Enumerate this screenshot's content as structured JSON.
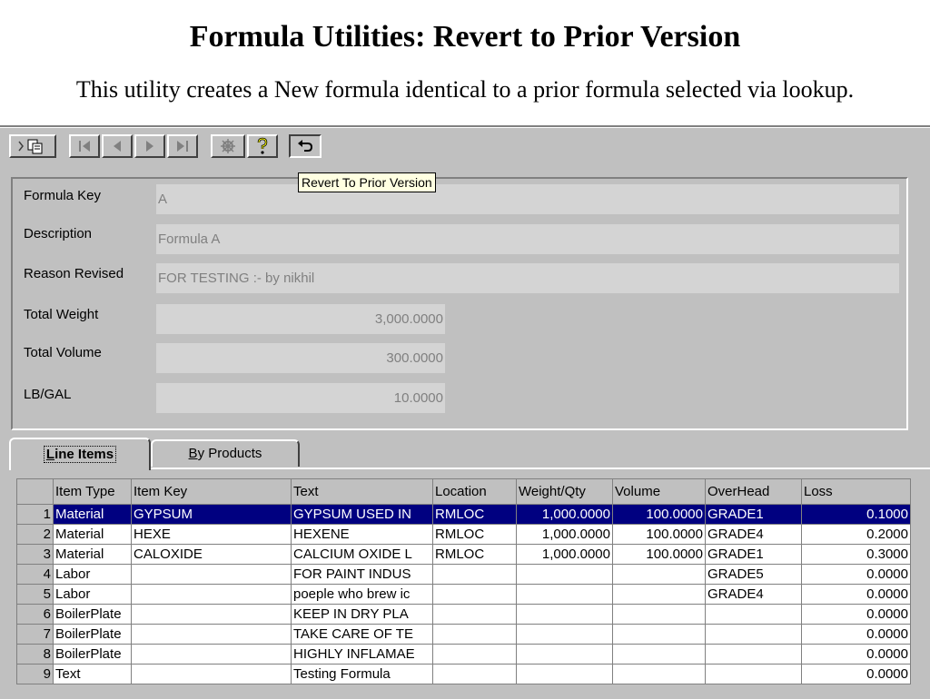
{
  "slide": {
    "title": "Formula Utilities: Revert to Prior Version",
    "subtitle": "This utility creates a New formula identical to a prior formula selected via lookup."
  },
  "toolbar": {
    "buttons": [
      "copy-icon",
      "first-record-icon",
      "previous-record-icon",
      "next-record-icon",
      "last-record-icon",
      "tools-icon",
      "help-icon",
      "revert-icon"
    ],
    "tooltip": "Revert To Prior Version"
  },
  "form": {
    "formula_key": {
      "label": "Formula Key",
      "value": "A"
    },
    "description": {
      "label": "Description",
      "value": "Formula A"
    },
    "reason_revised": {
      "label": "Reason Revised",
      "value": "FOR TESTING :- by nikhil"
    },
    "total_weight": {
      "label": "Total Weight",
      "value": "3,000.0000"
    },
    "total_volume": {
      "label": "Total Volume",
      "value": "300.0000"
    },
    "lb_gal": {
      "label": "LB/GAL",
      "value": "10.0000"
    }
  },
  "tabs": {
    "line_items": {
      "label_mnemonic": "L",
      "label_rest": "ine Items"
    },
    "by_products": {
      "label_mnemonic": "B",
      "label_rest": "y Products"
    }
  },
  "grid": {
    "columns": [
      "Item Type",
      "Item Key",
      "Text",
      "Location",
      "Weight/Qty",
      "Volume",
      "OverHead",
      "Loss"
    ],
    "rows": [
      {
        "n": "1",
        "type": "Material",
        "key": "GYPSUM",
        "text": "GYPSUM USED IN",
        "loc": "RMLOC",
        "wq": "1,000.0000",
        "vol": "100.0000",
        "oh": "GRADE1",
        "loss": "0.1000"
      },
      {
        "n": "2",
        "type": "Material",
        "key": "HEXE",
        "text": "HEXENE",
        "loc": "RMLOC",
        "wq": "1,000.0000",
        "vol": "100.0000",
        "oh": "GRADE4",
        "loss": "0.2000"
      },
      {
        "n": "3",
        "type": "Material",
        "key": "CALOXIDE",
        "text": "CALCIUM OXIDE L",
        "loc": "RMLOC",
        "wq": "1,000.0000",
        "vol": "100.0000",
        "oh": "GRADE1",
        "loss": "0.3000"
      },
      {
        "n": "4",
        "type": "Labor",
        "key": "",
        "text": "FOR PAINT INDUS",
        "loc": "",
        "wq": "",
        "vol": "",
        "oh": "GRADE5",
        "loss": "0.0000"
      },
      {
        "n": "5",
        "type": "Labor",
        "key": "",
        "text": "poeple who brew ic",
        "loc": "",
        "wq": "",
        "vol": "",
        "oh": "GRADE4",
        "loss": "0.0000"
      },
      {
        "n": "6",
        "type": "BoilerPlate",
        "key": "",
        "text": "KEEP IN DRY PLA",
        "loc": "",
        "wq": "",
        "vol": "",
        "oh": "",
        "loss": "0.0000"
      },
      {
        "n": "7",
        "type": "BoilerPlate",
        "key": "",
        "text": "TAKE CARE OF TE",
        "loc": "",
        "wq": "",
        "vol": "",
        "oh": "",
        "loss": "0.0000"
      },
      {
        "n": "8",
        "type": "BoilerPlate",
        "key": "",
        "text": "HIGHLY INFLAMAE",
        "loc": "",
        "wq": "",
        "vol": "",
        "oh": "",
        "loss": "0.0000"
      },
      {
        "n": "9",
        "type": "Text",
        "key": "",
        "text": "Testing Formula",
        "loc": "",
        "wq": "",
        "vol": "",
        "oh": "",
        "loss": "0.0000"
      }
    ]
  }
}
